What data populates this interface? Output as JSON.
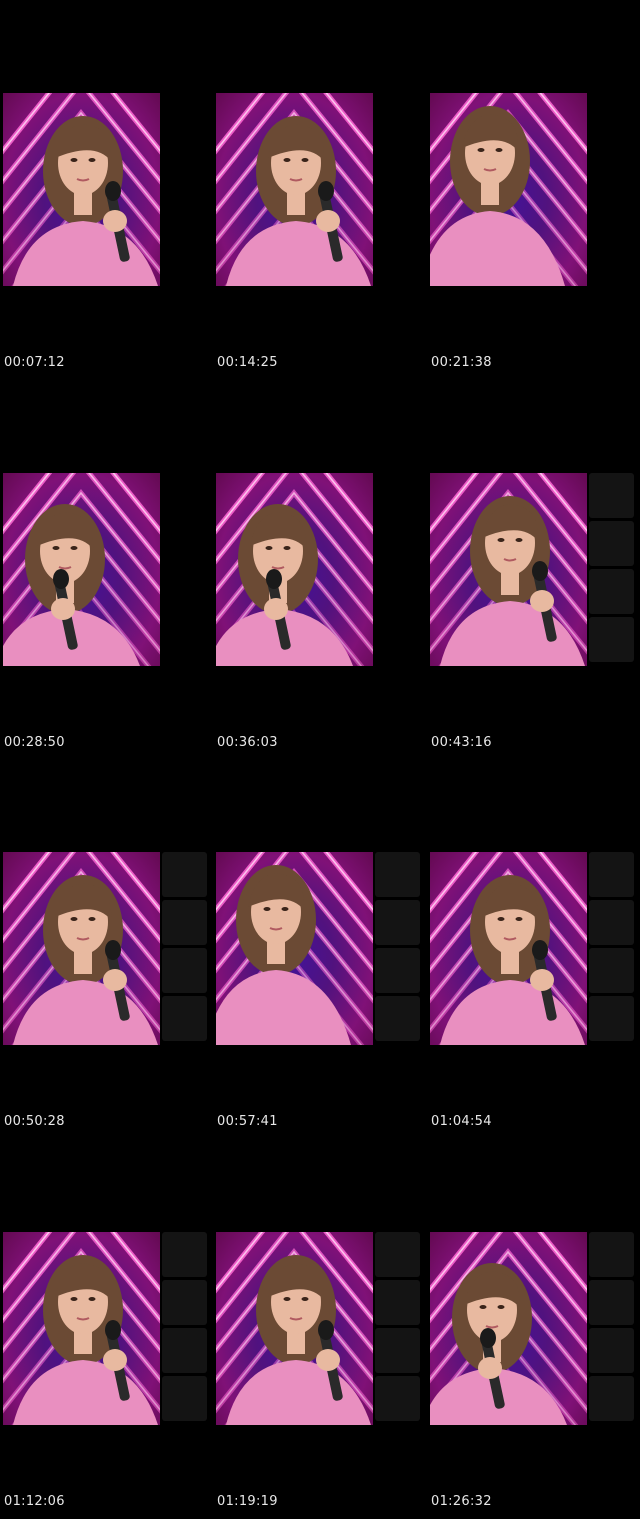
{
  "thumbnails": [
    {
      "timestamp": "00:07:12",
      "variant": "a",
      "side_panel": false
    },
    {
      "timestamp": "00:14:25",
      "variant": "a",
      "side_panel": false
    },
    {
      "timestamp": "00:21:38",
      "variant": "b",
      "side_panel": false
    },
    {
      "timestamp": "00:28:50",
      "variant": "c",
      "side_panel": false
    },
    {
      "timestamp": "00:36:03",
      "variant": "c",
      "side_panel": false
    },
    {
      "timestamp": "00:43:16",
      "variant": "a",
      "side_panel": true
    },
    {
      "timestamp": "00:50:28",
      "variant": "a",
      "side_panel": true
    },
    {
      "timestamp": "00:57:41",
      "variant": "b",
      "side_panel": true
    },
    {
      "timestamp": "01:04:54",
      "variant": "a",
      "side_panel": true
    },
    {
      "timestamp": "01:12:06",
      "variant": "a",
      "side_panel": true
    },
    {
      "timestamp": "01:19:19",
      "variant": "a",
      "side_panel": true
    },
    {
      "timestamp": "01:26:32",
      "variant": "c",
      "side_panel": true
    }
  ],
  "colors": {
    "background": "#000000",
    "neon": "#ff6ad5",
    "neon_core": "#ffd6f4",
    "shirt": "#e98fc0",
    "hair": "#6b4a34",
    "skin": "#e8b9a0",
    "mic": "#2a2a2a",
    "timestamp_text": "#e8e8e8"
  }
}
